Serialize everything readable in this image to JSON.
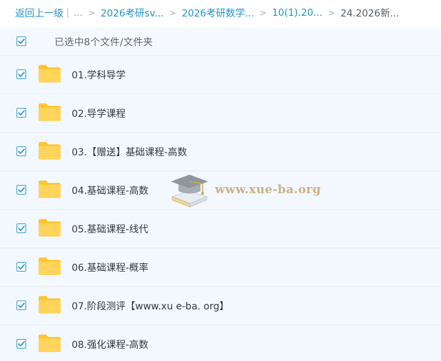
{
  "breadcrumb": {
    "back_label": "返回上一级",
    "ellipsis": "...",
    "crumbs": [
      {
        "label": "2026考研sv..."
      },
      {
        "label": "2026考研数学..."
      },
      {
        "label": "10(1).20..."
      }
    ],
    "current": "24.2026新..."
  },
  "selection": {
    "checked": true,
    "summary": "已选中8个文件/文件夹"
  },
  "files": [
    {
      "name": "01.学科导学",
      "checked": true,
      "type": "folder"
    },
    {
      "name": "02.导学课程",
      "checked": true,
      "type": "folder"
    },
    {
      "name": "03.【赠送】基础课程-高数",
      "checked": true,
      "type": "folder"
    },
    {
      "name": "04.基础课程-高数",
      "checked": true,
      "type": "folder"
    },
    {
      "name": "05.基础课程-线代",
      "checked": true,
      "type": "folder"
    },
    {
      "name": "06.基础课程-概率",
      "checked": true,
      "type": "folder"
    },
    {
      "name": "07.阶段测评【www.xu e-ba. org】",
      "checked": true,
      "type": "folder"
    },
    {
      "name": "08.强化课程-高数",
      "checked": true,
      "type": "folder"
    }
  ],
  "watermark": {
    "text": "www.xue-ba.org",
    "icon": "graduation-cap-books-logo"
  },
  "colors": {
    "link": "#1f93c9",
    "row_background": "#f2f8fe",
    "checkbox_accent": "#2f9ad4",
    "folder_yellow": "#ffcf4a"
  }
}
